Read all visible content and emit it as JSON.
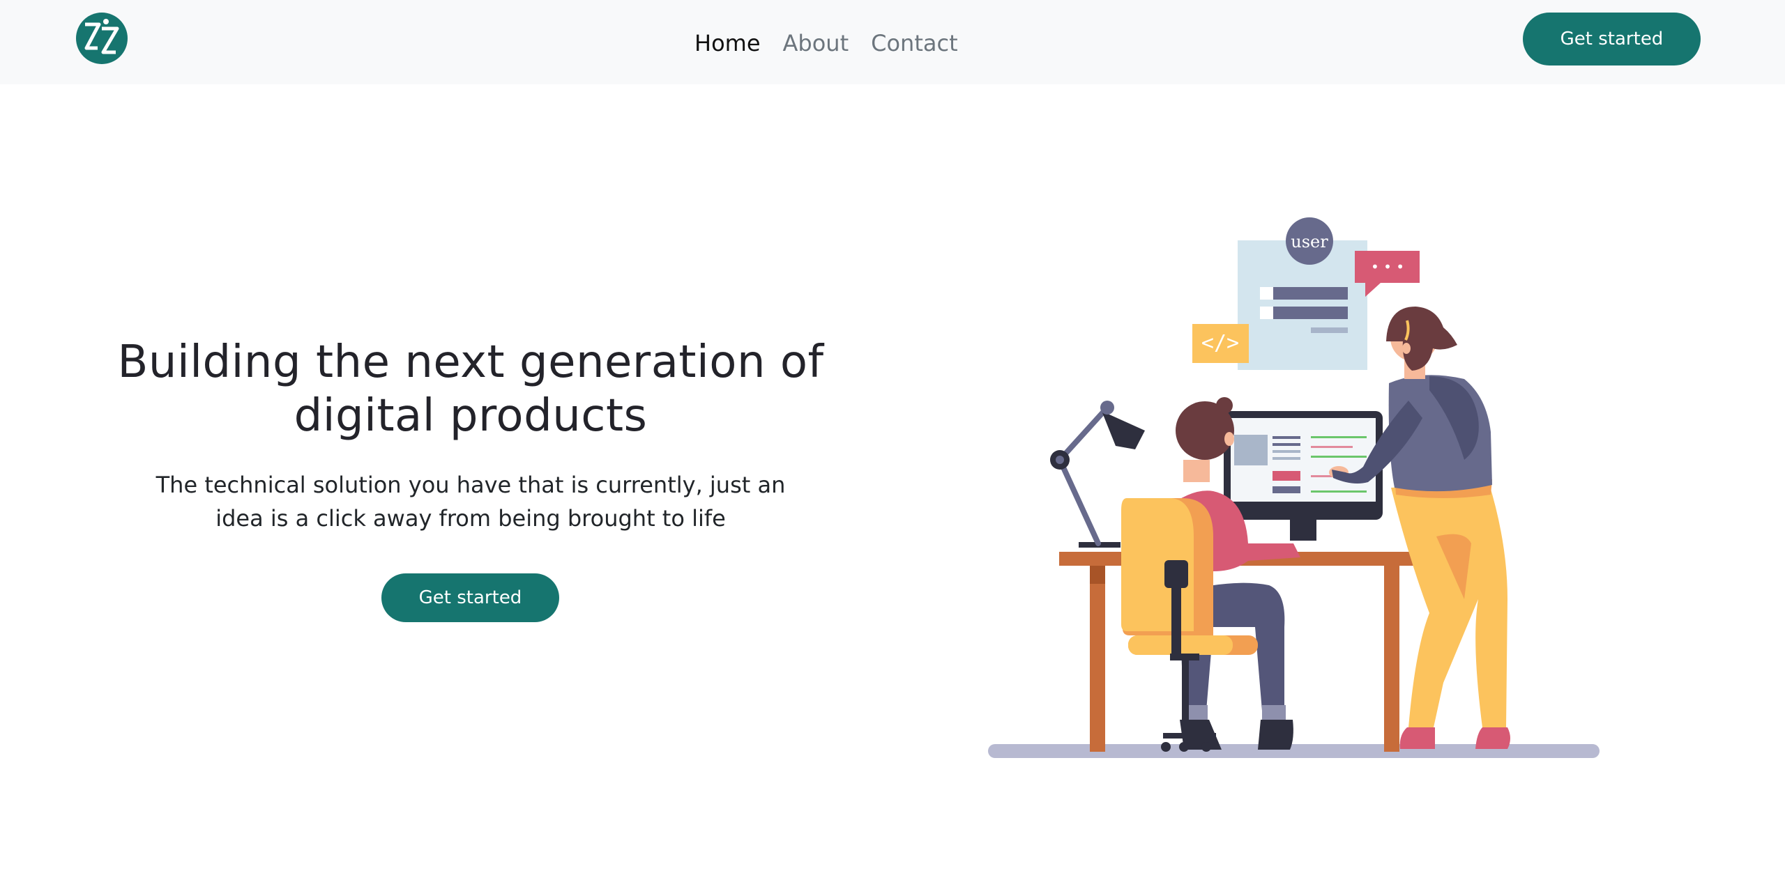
{
  "nav": {
    "logo_icon": "zz-monogram-logo-icon",
    "links": [
      "Home",
      "About",
      "Contact"
    ],
    "active": "Home",
    "cta_label": "Get started"
  },
  "hero": {
    "title": "Building the next generation of digital products",
    "subtitle": "The technical solution you have that is currently, just an idea is a click away from being brought to life",
    "cta_label": "Get started"
  },
  "illustration": {
    "avatar_label": "user",
    "code_tag": "</>",
    "chat_dots": "• • •"
  },
  "colors": {
    "accent": "#16756f",
    "navbar_bg": "#f8f9fa",
    "heading": "#23232a",
    "nav_inactive": "#6c757d"
  }
}
